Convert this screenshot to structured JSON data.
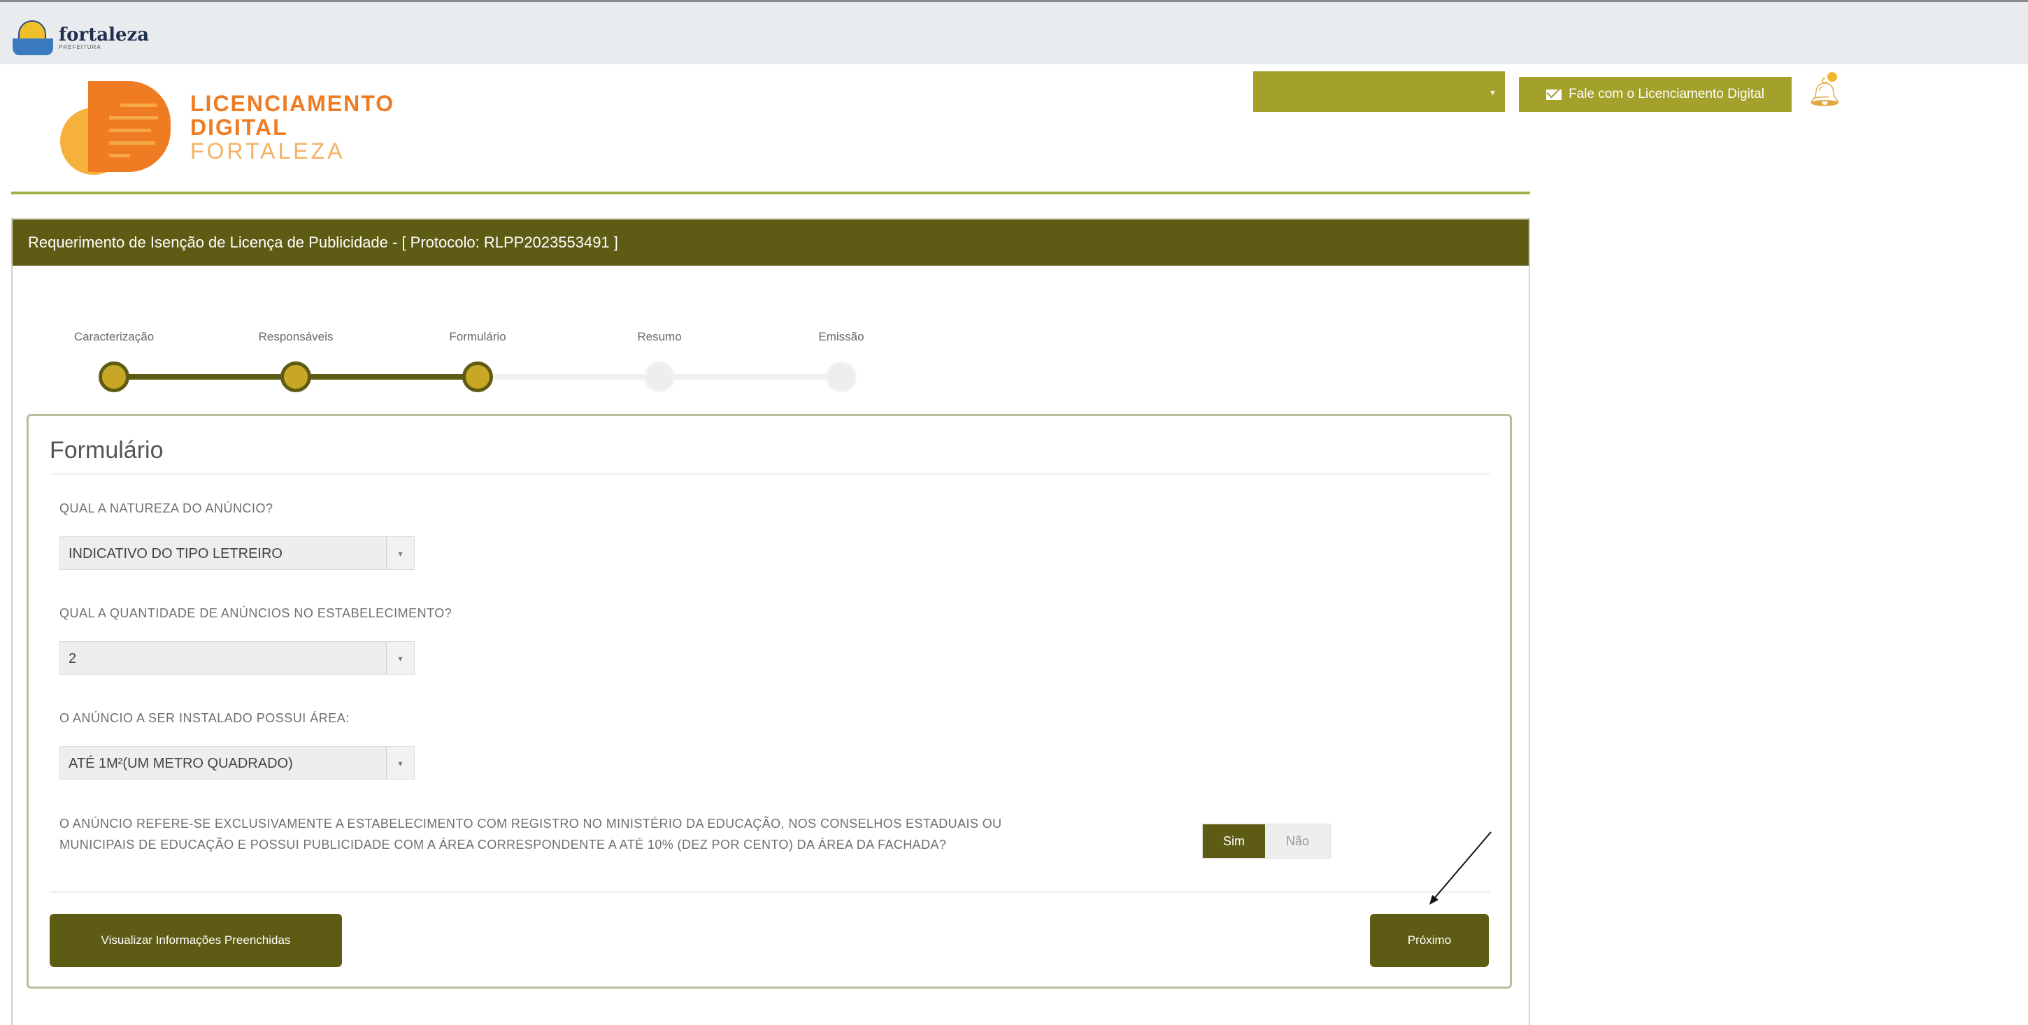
{
  "header": {
    "city_name": "fortaleza",
    "city_sub": "PREFEITURA",
    "brand_line1": "LICENCIAMENTO",
    "brand_line2": "DIGITAL",
    "brand_line3": "FORTALEZA",
    "user_dropdown_value": "",
    "contact_button": "Fale com o Licenciamento Digital",
    "contact_icon": "envelope-icon",
    "bell_icon": "bell-icon"
  },
  "panel": {
    "title": "Requerimento de Isenção de Licença de Publicidade - [ Protocolo: RLPP2023553491 ]"
  },
  "stepper": {
    "steps": [
      {
        "label": "Caracterização",
        "status": "done"
      },
      {
        "label": "Responsáveis",
        "status": "done"
      },
      {
        "label": "Formulário",
        "status": "current"
      },
      {
        "label": "Resumo",
        "status": "pending"
      },
      {
        "label": "Emissão",
        "status": "pending"
      }
    ]
  },
  "form": {
    "title": "Formulário",
    "q1": {
      "label": "QUAL A NATUREZA DO ANÚNCIO?",
      "value": "INDICATIVO DO TIPO LETREIRO"
    },
    "q2": {
      "label": "QUAL A QUANTIDADE DE ANÚNCIOS NO ESTABELECIMENTO?",
      "value": "2"
    },
    "q3": {
      "label": "O ANÚNCIO A SER INSTALADO POSSUI ÁREA:",
      "value": "ATÉ 1M²(UM METRO QUADRADO)"
    },
    "q4": {
      "label_line1": "O ANÚNCIO REFERE-SE EXCLUSIVAMENTE A ESTABELECIMENTO COM REGISTRO NO MINISTÉRIO DA EDUCAÇÃO, NOS CONSELHOS ESTADUAIS OU",
      "label_line2": "MUNICIPAIS DE EDUCAÇÃO E POSSUI PUBLICIDADE COM A ÁREA CORRESPONDENTE A ATÉ 10% (DEZ POR CENTO) DA ÁREA DA FACHADA?",
      "yes": "Sim",
      "no": "Não",
      "selected": "Sim"
    },
    "view_button": "Visualizar Informações Preenchidas",
    "next_button": "Próximo"
  },
  "colors": {
    "olive_dark": "#5e5c14",
    "olive_light": "#a3a12b",
    "accent_gold": "#c9a726",
    "brand_orange": "#ef7b22"
  }
}
